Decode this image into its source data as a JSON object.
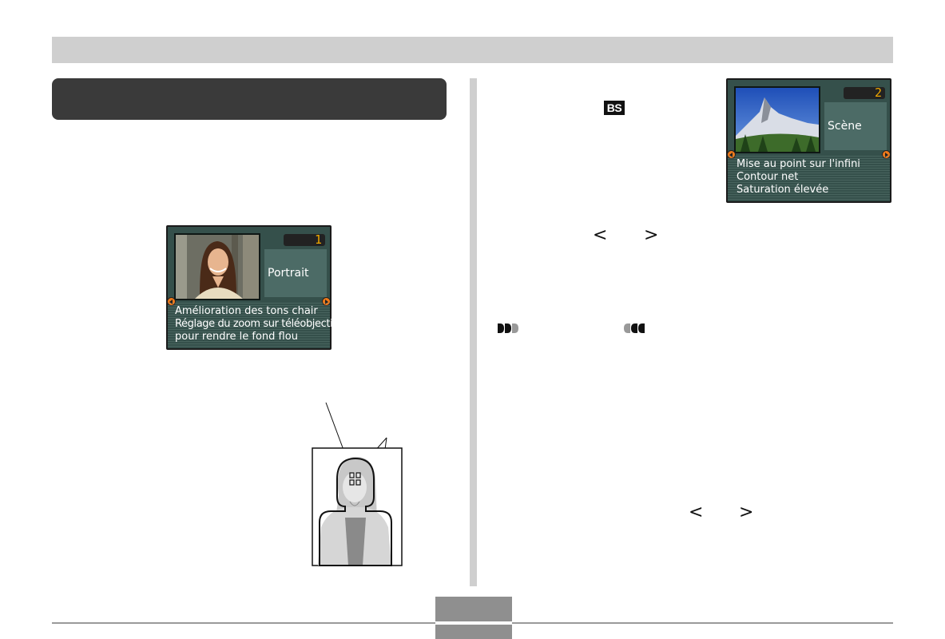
{
  "screens": {
    "portrait": {
      "number": "1",
      "scene_name": "Portrait",
      "description_lines": [
        "Amélioration des tons chair",
        "Réglage du zoom sur téléobjectif",
        "pour rendre le fond flou"
      ]
    },
    "landscape": {
      "number": "2",
      "scene_name": "Scène",
      "description_lines": [
        "Mise au point sur l'infini",
        "Contour net",
        "Saturation élevée"
      ]
    }
  },
  "icons": {
    "badge_text": "BS",
    "arrow_left": "<",
    "arrow_right": ">"
  },
  "colors": {
    "lcd_background": "#35504b",
    "lcd_number": "#f0a800",
    "nav_arrow": "#f07a1a",
    "header_bar": "#cfcfcf",
    "title_bar": "#3a3a3a"
  }
}
